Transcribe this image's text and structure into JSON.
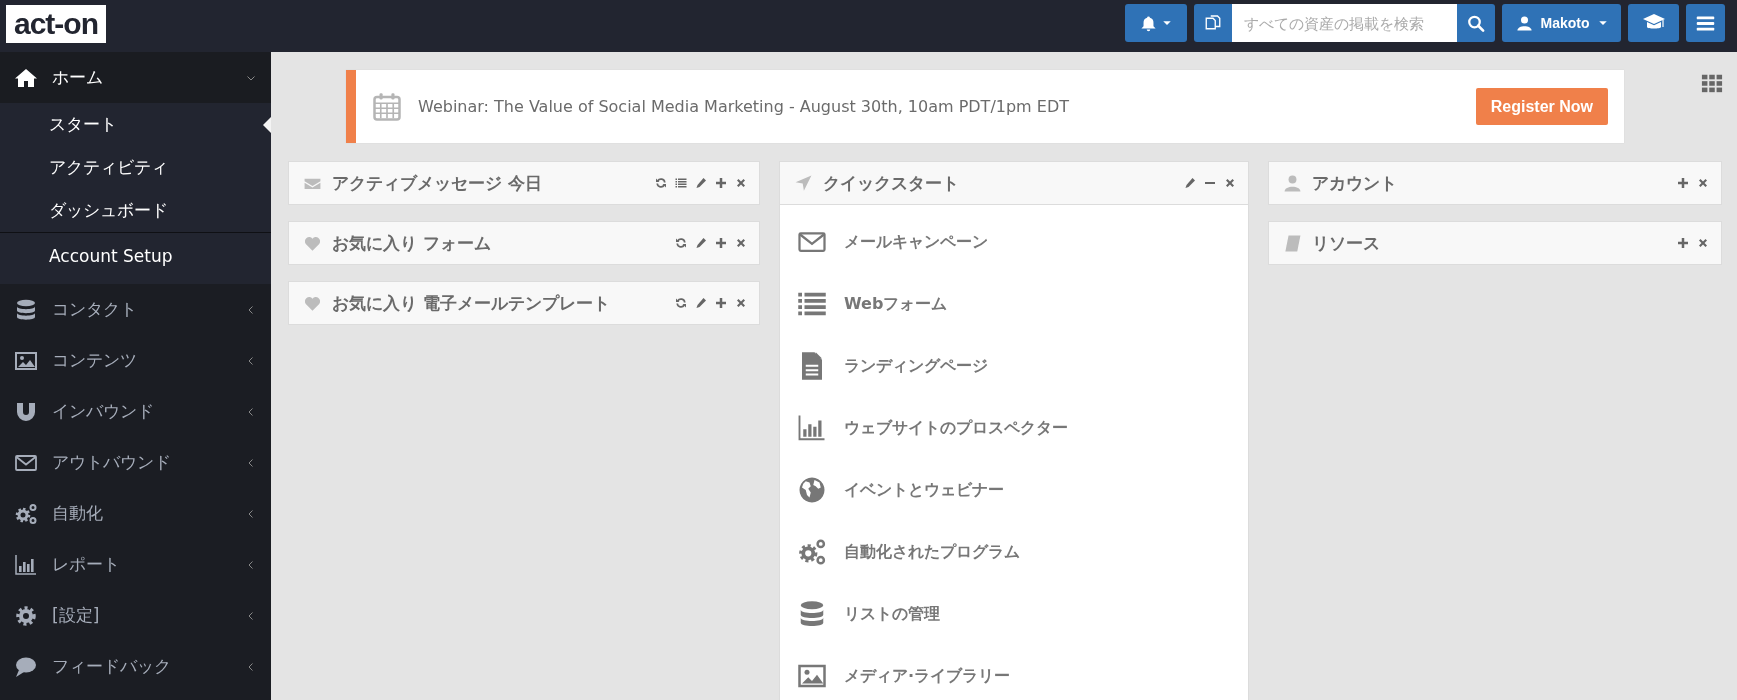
{
  "topbar": {
    "logo": "act-on",
    "search": {
      "placeholder": "すべての資産の掲載を検索"
    },
    "user": {
      "name": "Makoto"
    }
  },
  "sidebar": {
    "items": [
      {
        "label": "ホーム",
        "expanded": true,
        "children": [
          {
            "label": "スタート",
            "kind": "page",
            "selected": true
          },
          {
            "label": "アクティビティ",
            "kind": "page",
            "selected": false
          },
          {
            "label": "ダッシュボード",
            "kind": "page",
            "selected": false
          },
          {
            "label": "Account Setup",
            "kind": "setup",
            "selected": false
          }
        ]
      },
      {
        "label": "コンタクト",
        "expanded": false
      },
      {
        "label": "コンテンツ",
        "expanded": false
      },
      {
        "label": "インバウンド",
        "expanded": false
      },
      {
        "label": "アウトバウンド",
        "expanded": false
      },
      {
        "label": "自動化",
        "expanded": false
      },
      {
        "label": "レポート",
        "expanded": false
      },
      {
        "label": "[設定]",
        "expanded": false
      },
      {
        "label": "フィードバック",
        "expanded": false
      }
    ]
  },
  "banner": {
    "text": "Webinar: The Value of Social Media Marketing - August 30th, 10am PDT/1pm EDT",
    "button": "Register Now"
  },
  "columns": [
    [
      {
        "title": "アクティブメッセージ 今日",
        "actions": [
          {
            "kind": "refresh"
          },
          {
            "kind": "list"
          },
          {
            "kind": "edit"
          },
          {
            "kind": "add"
          },
          {
            "kind": "close"
          }
        ]
      },
      {
        "title": "お気に入り フォーム",
        "actions": [
          {
            "kind": "refresh"
          },
          {
            "kind": "edit"
          },
          {
            "kind": "add"
          },
          {
            "kind": "close"
          }
        ]
      },
      {
        "title": "お気に入り 電子メールテンプレート",
        "actions": [
          {
            "kind": "refresh"
          },
          {
            "kind": "edit"
          },
          {
            "kind": "add"
          },
          {
            "kind": "close"
          }
        ]
      }
    ],
    [
      {
        "title": "クイックスタート",
        "actions": [
          {
            "kind": "edit"
          },
          {
            "kind": "minimize"
          },
          {
            "kind": "close"
          }
        ],
        "items": [
          "メールキャンペーン",
          "Webフォーム",
          "ランディングページ",
          "ウェブサイトのプロスペクター",
          "イベントとウェビナー",
          "自動化されたプログラム",
          "リストの管理",
          "メディア·ライブラリー"
        ]
      }
    ],
    [
      {
        "title": "アカウント",
        "actions": [
          {
            "kind": "add"
          },
          {
            "kind": "close"
          }
        ]
      },
      {
        "title": "リソース",
        "actions": [
          {
            "kind": "add"
          },
          {
            "kind": "close"
          }
        ]
      }
    ]
  ]
}
